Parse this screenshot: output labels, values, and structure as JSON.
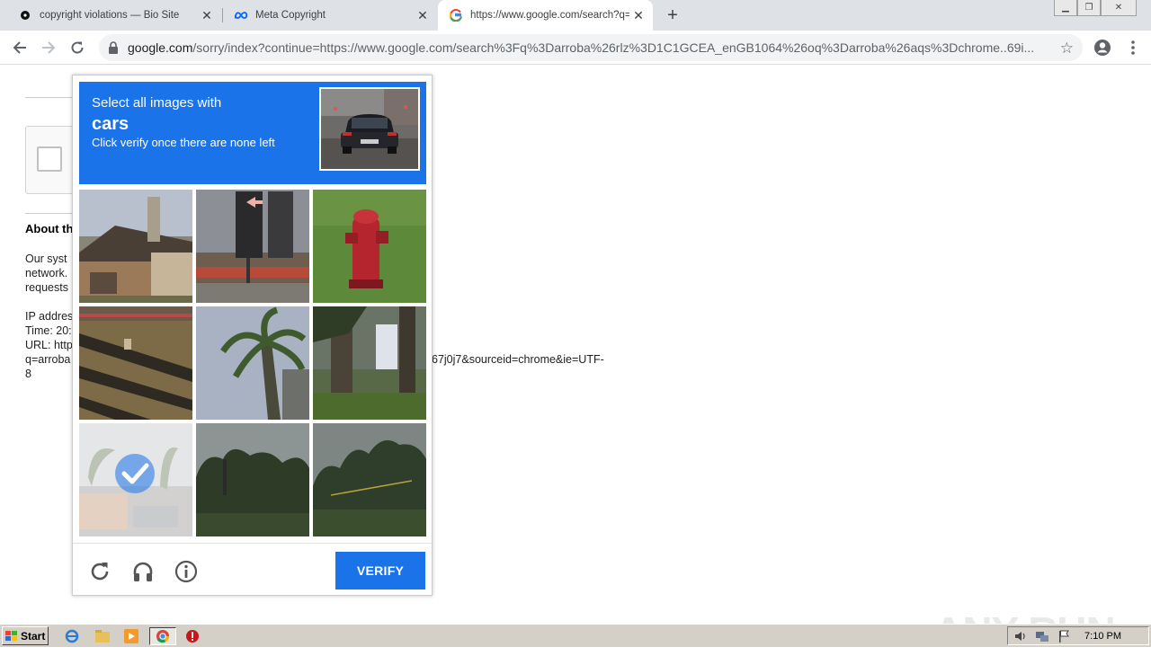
{
  "tabs": [
    {
      "title": "copyright violations — Bio Site",
      "favicon": "dark-circle-icon"
    },
    {
      "title": "Meta Copyright",
      "favicon": "meta-logo-icon"
    },
    {
      "title": "https://www.google.com/search?q=",
      "favicon": "google-logo-icon",
      "active": true
    }
  ],
  "address_bar": {
    "host": "google.com",
    "path": "/sorry/index?continue=https://www.google.com/search%3Fq%3Darroba%26rlz%3D1C1GCEA_enGB1064%26oq%3Darroba%26aqs%3Dchrome..69i..."
  },
  "background_page": {
    "about_heading": "About th",
    "para_lines": [
      "Our syst",
      "network.",
      "requests"
    ],
    "info_lines": [
      "IP addres",
      "Time: 20:",
      "URL: http",
      "q=arroba",
      "8"
    ],
    "url_tail": "67j0j7&sourceid=chrome&ie=UTF-"
  },
  "captcha": {
    "prompt_line1": "Select all images with",
    "target": "cars",
    "prompt_line3": "Click verify once there are none left",
    "tiles": [
      {
        "subject": "house roof",
        "selected": false
      },
      {
        "subject": "traffic light",
        "selected": false
      },
      {
        "subject": "fire hydrant",
        "selected": false
      },
      {
        "subject": "fence shadows",
        "selected": false
      },
      {
        "subject": "palm tree",
        "selected": false
      },
      {
        "subject": "tree trunks",
        "selected": false
      },
      {
        "subject": "street scene",
        "selected": true
      },
      {
        "subject": "trees",
        "selected": false
      },
      {
        "subject": "trees",
        "selected": false
      }
    ],
    "verify_label": "VERIFY"
  },
  "watermark": "ANY RUN",
  "taskbar": {
    "start_label": "Start",
    "clock": "7:10 PM"
  },
  "colors": {
    "captcha_blue": "#1a73e8",
    "tab_bar": "#dee1e6",
    "taskbar": "#d4d0c8"
  }
}
